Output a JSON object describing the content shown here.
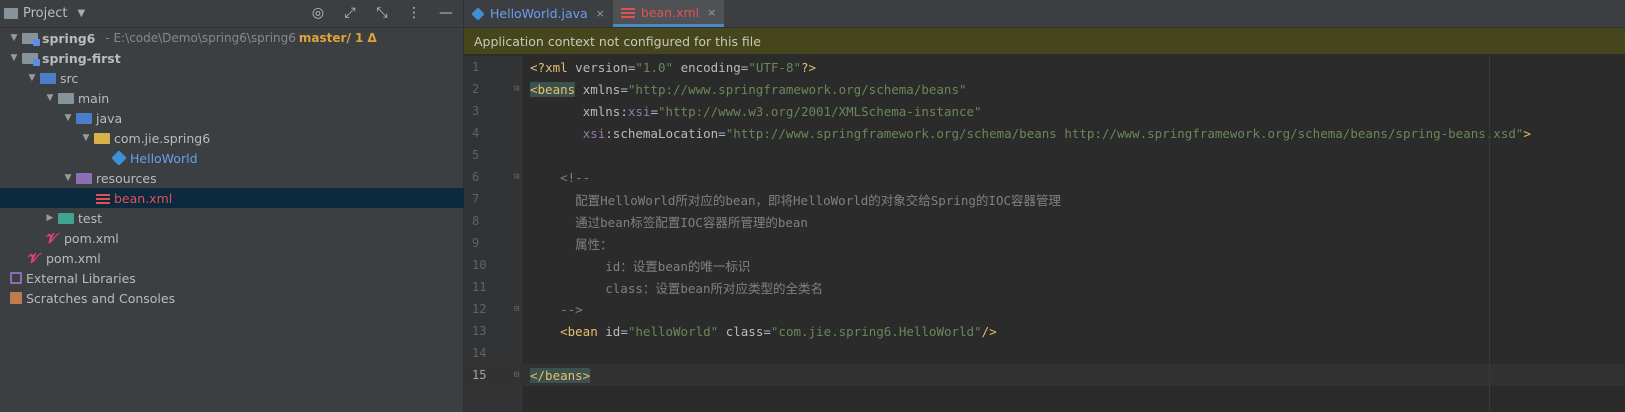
{
  "project": {
    "title": "Project",
    "tree": [
      {
        "label": "spring6",
        "hint": "- E:\\code\\Demo\\spring6\\spring6",
        "branch": "master/ 1 Δ"
      },
      {
        "label": "spring-first"
      },
      {
        "label": "src"
      },
      {
        "label": "main"
      },
      {
        "label": "java"
      },
      {
        "label": "com.jie.spring6"
      },
      {
        "label": "HelloWorld"
      },
      {
        "label": "resources"
      },
      {
        "label": "bean.xml"
      },
      {
        "label": "test"
      },
      {
        "label": "pom.xml"
      },
      {
        "label": "pom.xml"
      },
      {
        "label": "External Libraries"
      },
      {
        "label": "Scratches and Consoles"
      }
    ]
  },
  "tabs": [
    {
      "label": "HelloWorld.java",
      "close": "×"
    },
    {
      "label": "bean.xml",
      "close": "×"
    }
  ],
  "banner": "Application context not configured for this file",
  "code": {
    "line_numbers": [
      "1",
      "2",
      "3",
      "4",
      "5",
      "6",
      "7",
      "8",
      "9",
      "10",
      "11",
      "12",
      "13",
      "14",
      "15"
    ],
    "current_line": "15"
  },
  "colors": {
    "accent": "#4a88c7",
    "selection": "#0d293e",
    "banner": "#46461d"
  }
}
